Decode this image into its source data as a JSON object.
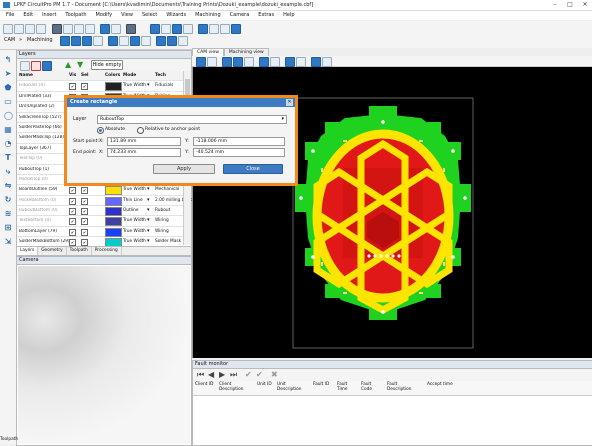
{
  "window": {
    "title": "LPKF CircuitPro PM 1.7 - Document [C:\\Users\\kvadimin\\Documents\\Training Prints\\Dozuki_example\\dozuki_example.cbf]",
    "minimize": "–",
    "maximize": "□",
    "close": "✕"
  },
  "menu": [
    "File",
    "Edit",
    "Insert",
    "Toolpath",
    "Modify",
    "View",
    "Select",
    "Wizards",
    "Machining",
    "Camera",
    "Extras",
    "Help"
  ],
  "toolbar": {
    "cam_label": "CAM",
    "machining_label": "Machining",
    "separator": "»"
  },
  "layers_panel": {
    "title": "Layers",
    "hide_empty_label": "Hide empty",
    "columns": [
      "Name",
      "Vis",
      "Sel",
      "Colors",
      "Mode",
      "Tech"
    ],
    "rows": [
      {
        "name": "Fiducials (0)",
        "vis": true,
        "sel": true,
        "color": "#222222",
        "mode": "True Width",
        "tech": "Fiducials",
        "dim": true
      },
      {
        "name": "DrillPlated (33)",
        "vis": true,
        "sel": true,
        "color": "#3a3a3a",
        "mode": "True Width",
        "tech": "Drilling",
        "dim": false
      },
      {
        "name": "DrillUnplated (2)",
        "vis": true,
        "sel": true,
        "color": "#555555",
        "mode": "",
        "tech": "",
        "dim": false
      },
      {
        "name": "SilkScreenTop (527)",
        "vis": true,
        "sel": true,
        "color": "#ffffff",
        "mode": "",
        "tech": "",
        "dim": false
      },
      {
        "name": "SolderPasteTop (66)",
        "vis": true,
        "sel": true,
        "color": "#cccccc",
        "mode": "",
        "tech": "",
        "dim": false
      },
      {
        "name": "SolderMaskTop (128)",
        "vis": true,
        "sel": true,
        "color": "#00aa00",
        "mode": "",
        "tech": "",
        "dim": false
      },
      {
        "name": "TopLayer (367)",
        "vis": true,
        "sel": true,
        "color": "#ff2020",
        "mode": "",
        "tech": "",
        "dim": false
      },
      {
        "name": "TextTop (0)",
        "vis": true,
        "sel": true,
        "color": "#ff8080",
        "mode": "",
        "tech": "",
        "dim": true
      },
      {
        "name": "RuboutTop (1)",
        "vis": true,
        "sel": true,
        "color": "#ffff00",
        "mode": "",
        "tech": "",
        "dim": false
      },
      {
        "name": "PocketTop (0)",
        "vis": true,
        "sel": true,
        "color": "#ff00ff",
        "mode": "",
        "tech": "",
        "dim": true
      },
      {
        "name": "BoardOutline (59)",
        "vis": true,
        "sel": true,
        "color": "#ffe000",
        "mode": "True Width",
        "tech": "Mechanical",
        "dim": false
      },
      {
        "name": "PocketBottom (0)",
        "vis": true,
        "sel": true,
        "color": "#6666ff",
        "mode": "Thin Line",
        "tech": "2.00 milling bottom",
        "dim": true
      },
      {
        "name": "RuboutBottom (0)",
        "vis": true,
        "sel": true,
        "color": "#3030cc",
        "mode": "Outline",
        "tech": "Rubout",
        "dim": true
      },
      {
        "name": "TextBottom (0)",
        "vis": true,
        "sel": true,
        "color": "#4040a0",
        "mode": "True Width",
        "tech": "Wiring",
        "dim": true
      },
      {
        "name": "BottomLayer (79)",
        "vis": true,
        "sel": true,
        "color": "#1a40ff",
        "mode": "True Width",
        "tech": "Wiring",
        "dim": false
      },
      {
        "name": "SolderMaskBottom (29)",
        "vis": true,
        "sel": true,
        "color": "#00cccc",
        "mode": "True Width",
        "tech": "Solder Mask",
        "dim": false
      }
    ],
    "tabs": [
      "Layers",
      "Geometry",
      "Toolpath",
      "Processing"
    ]
  },
  "camera_panel": {
    "title": "Camera"
  },
  "cam_tabs": [
    "CAM view",
    "Machining view"
  ],
  "dialog": {
    "title": "Create rectangle",
    "layer_label": "Layer",
    "layer_value": "RuboutTop",
    "absolute_label": "Absolute",
    "relative_label": "Relative to anchor point",
    "start_label": "Start point:",
    "end_label": "End point:",
    "x_label": "X:",
    "y_label": "Y:",
    "start_x": "131.89 mm",
    "start_y": "-118.006 mm",
    "end_x": "74.233 mm",
    "end_y": "-40.524 mm",
    "apply_label": "Apply",
    "close_label": "Close",
    "close_icon": "✕"
  },
  "fault_monitor": {
    "title": "Fault monitor",
    "columns": [
      "Client ID",
      "Client Description",
      "Unit ID",
      "Unit Description",
      "Fault ID",
      "Fault Time",
      "Fault Code",
      "Fault Description",
      "Accept time"
    ]
  },
  "bottom_label": "Toolpath",
  "colors": {
    "accent": "#3d7bc3",
    "highlight": "#f08a1e",
    "board_green": "#1fd21f",
    "board_yellow": "#ffe400",
    "board_red": "#e01818"
  }
}
